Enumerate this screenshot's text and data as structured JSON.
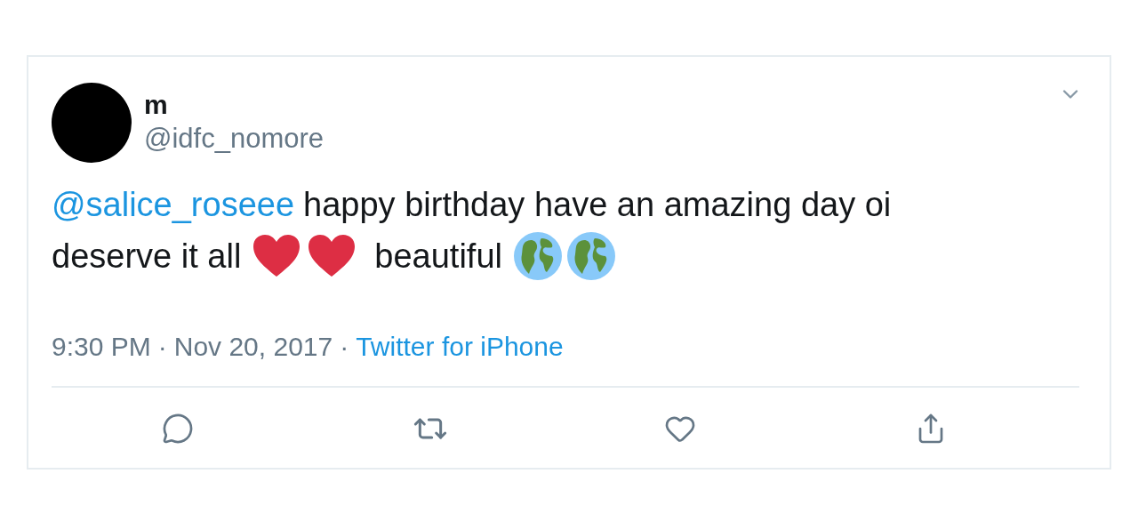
{
  "author": {
    "name": "m",
    "handle": "@idfc_nomore"
  },
  "tweet": {
    "mention": "@salice_roseee",
    "line_1": "happy birthday have an amazing day oi",
    "line_2_start": "deserve it all",
    "line_2_end": "beautiful"
  },
  "meta": {
    "time": "9:30 PM",
    "separator_1": "·",
    "date": "Nov 20, 2017",
    "separator_2": "·",
    "source": "Twitter for iPhone"
  }
}
